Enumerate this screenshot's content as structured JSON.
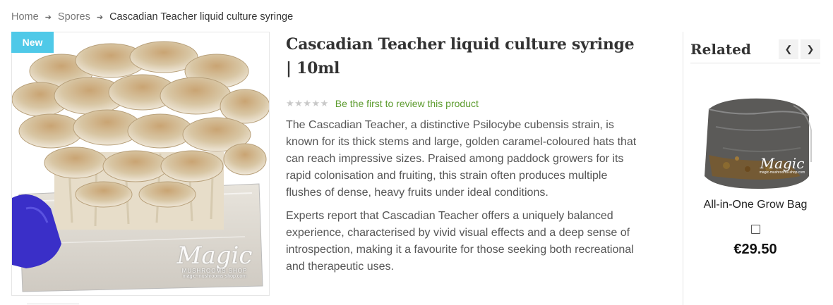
{
  "breadcrumb": {
    "home": "Home",
    "category": "Spores",
    "current": "Cascadian Teacher liquid culture syringe",
    "separator_icon": "arrow-right-icon"
  },
  "product": {
    "badge": "New",
    "title": "Cascadian Teacher liquid culture syringe | 10ml",
    "stars": "★★★★★",
    "star_color": "#c9c9c9",
    "review_link": "Be the first to review this product",
    "review_color": "#5c9b2e",
    "description": [
      "The Cascadian Teacher, a distinctive Psilocybe cubensis strain, is known for its thick stems and large, golden caramel-coloured hats that can reach impressive sizes. Praised among paddock growers for its rapid colonisation and fruiting, this strain often produces multiple flushes of dense, heavy fruits under ideal conditions.",
      "Experts report that Cascadian Teacher offers a uniquely balanced experience, characterised by vivid visual effects and a deep sense of introspection, making it a favourite for those seeking both recreational and therapeutic uses."
    ],
    "image_watermark": "Magic",
    "image_watermark_sub": "MUSHROOMS SHOP",
    "image_watermark_url": "magic-mushrooms-shop.com"
  },
  "related": {
    "title": "Related",
    "prev_icon": "chevron-left-icon",
    "next_icon": "chevron-right-icon",
    "items": [
      {
        "name": "All-in-One Grow Bag",
        "price": "€29.50",
        "watermark": "Magic",
        "watermark_url": "magic-mushrooms-shop.com"
      }
    ]
  },
  "colors": {
    "badge_bg": "#4fc9e8",
    "glove": "#3a2fc8"
  }
}
